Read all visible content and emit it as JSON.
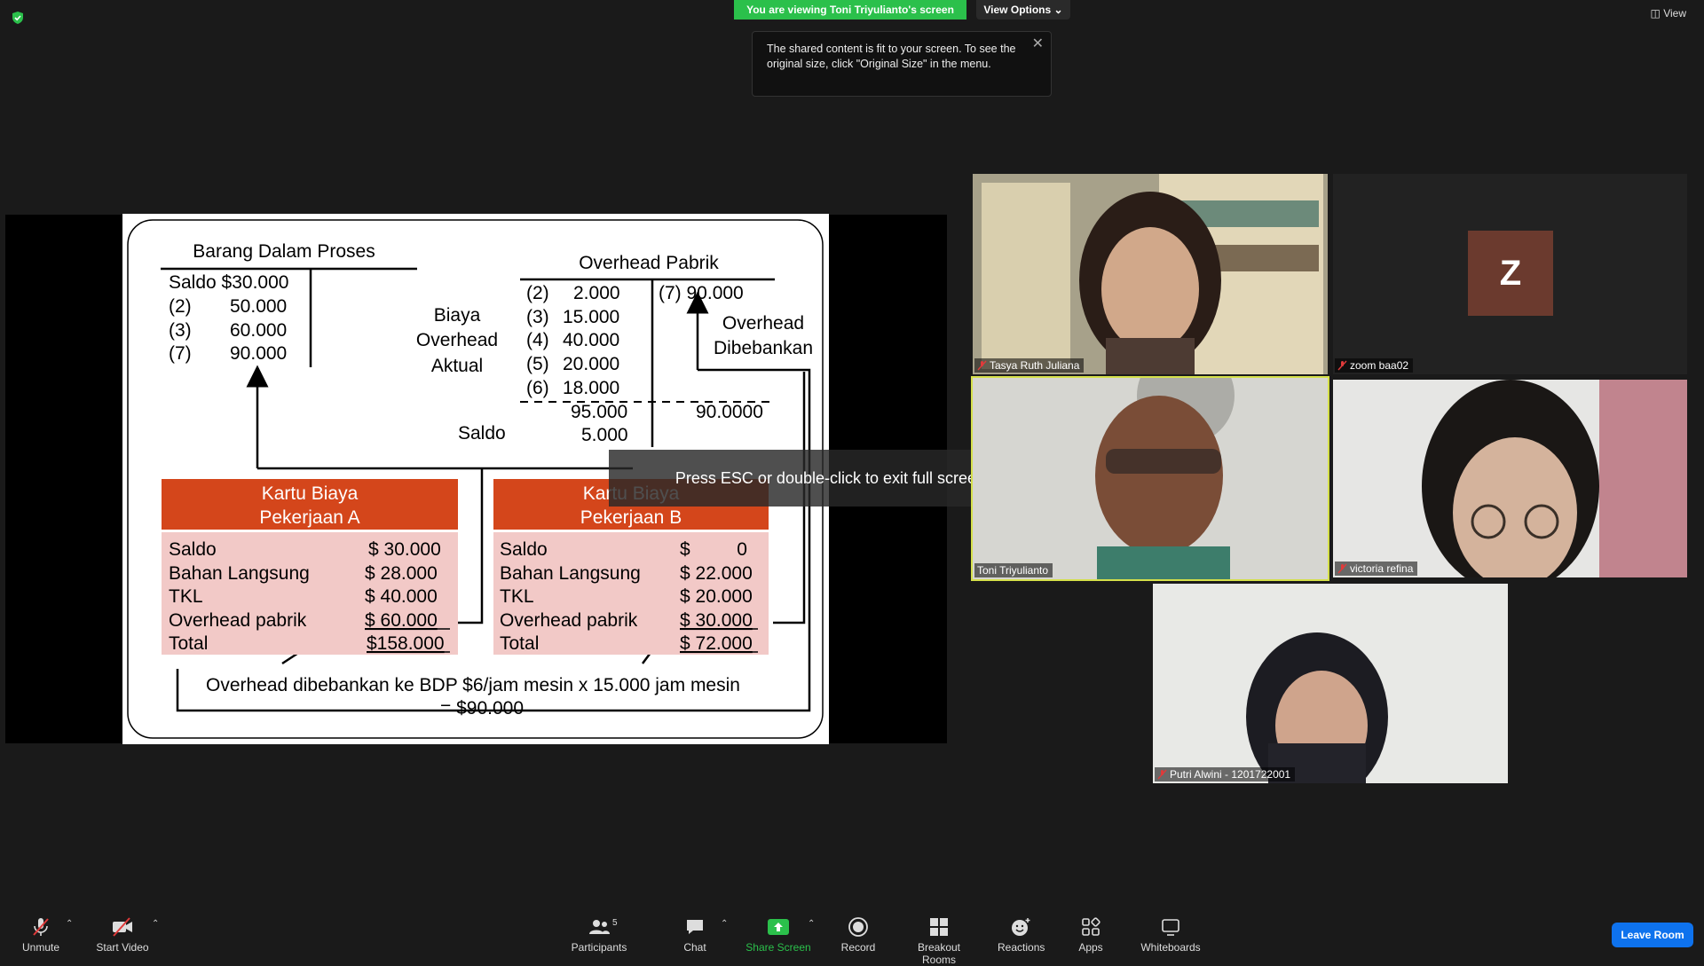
{
  "header": {
    "viewing_banner": "You are viewing Toni Triyulianto's screen",
    "view_options_label": "View Options",
    "view_button_label": "View"
  },
  "tooltip": {
    "text": "The shared content is fit to your screen. To see the original size, click \"Original Size\" in the menu."
  },
  "slide": {
    "bdp": {
      "title": "Barang Dalam Proses",
      "rows": [
        "Saldo $30.000",
        "(2)",
        "50.000",
        "(3)",
        "60.000",
        "(7)",
        "90.000"
      ]
    },
    "overhead": {
      "title": "Overhead Pabrik",
      "debit_nums": [
        "(2)",
        "(3)",
        "(4)",
        "(5)",
        "(6)"
      ],
      "debit_vals": [
        "2.000",
        "15.000",
        "40.000",
        "20.000",
        "18.000"
      ],
      "credit_entry": "(7) 90.000",
      "debit_total": "95.000",
      "credit_total": "90.0000",
      "saldo_label": "Saldo",
      "saldo_value": "5.000"
    },
    "label_biaya": [
      "Biaya",
      "Overhead",
      "Aktual"
    ],
    "label_dibebankan": [
      "Overhead",
      "Dibebankan"
    ],
    "card_a": {
      "title1": "Kartu Biaya",
      "title2": "Pekerjaan A",
      "labels": [
        "Saldo",
        "Bahan Langsung",
        "TKL",
        "Overhead pabrik",
        "Total"
      ],
      "values": [
        "$ 30.000",
        "$  28.000",
        "$  40.000",
        "$  60.000",
        "$158.000"
      ]
    },
    "card_b": {
      "title1": "Kartu Biaya",
      "title2": "Pekerjaan B",
      "labels": [
        "Saldo",
        "Bahan Langsung",
        "TKL",
        "Overhead pabrik",
        "Total"
      ],
      "values": [
        "$         0",
        "$ 22.000",
        "$ 20.000",
        "$ 30.000",
        "$ 72.000"
      ]
    },
    "footer_line1": "Overhead dibebankan ke BDP $6/jam mesin x 15.000 jam mesin",
    "footer_line2": "= $90.000"
  },
  "esc_overlay": "Press ESC or double-click to exit full screen mode",
  "participants": {
    "tasya": "Tasya Ruth Juliana",
    "zoom": "zoom baa02",
    "zoom_initial": "Z",
    "toni": "Toni Triyulianto",
    "victoria": "victoria refina",
    "putri": "Putri Alwini - 1201722001"
  },
  "toolbar": {
    "unmute": "Unmute",
    "start_video": "Start Video",
    "participants": "Participants",
    "participants_count": "5",
    "chat": "Chat",
    "share_screen": "Share Screen",
    "record": "Record",
    "breakout_rooms": "Breakout Rooms",
    "reactions": "Reactions",
    "apps": "Apps",
    "whiteboards": "Whiteboards",
    "leave_room": "Leave Room"
  },
  "colors": {
    "green_banner": "#2bc04b",
    "card_header": "#d4461b",
    "card_body": "#f2c9c7",
    "leave_blue": "#0e72ed",
    "active_speaker": "#d5e04a"
  }
}
